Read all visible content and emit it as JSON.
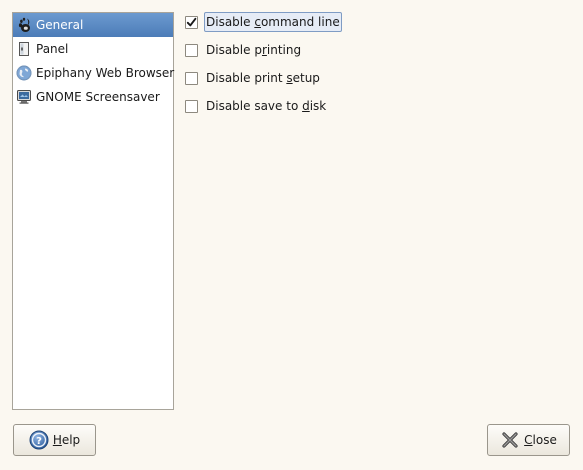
{
  "sidebar": {
    "items": [
      {
        "label": "General",
        "icon": "gnome-foot-icon",
        "selected": true
      },
      {
        "label": "Panel",
        "icon": "panel-icon",
        "selected": false
      },
      {
        "label": "Epiphany Web Browser",
        "icon": "globe-icon",
        "selected": false
      },
      {
        "label": "GNOME Screensaver",
        "icon": "monitor-icon",
        "selected": false
      }
    ]
  },
  "options": [
    {
      "label": "Disable command line",
      "mnemonic_index": 8,
      "checked": true,
      "focused": true
    },
    {
      "label": "Disable printing",
      "mnemonic_index": 9,
      "checked": false,
      "focused": false
    },
    {
      "label": "Disable print setup",
      "mnemonic_index": 14,
      "checked": false,
      "focused": false
    },
    {
      "label": "Disable save to disk",
      "mnemonic_index": 16,
      "checked": false,
      "focused": false
    }
  ],
  "buttons": {
    "help_label": "Help",
    "help_icon": "help-icon",
    "close_label": "Close",
    "close_icon": "close-icon"
  },
  "colors": {
    "selection": "#5a88c4",
    "window_bg": "#fbf8f1"
  }
}
